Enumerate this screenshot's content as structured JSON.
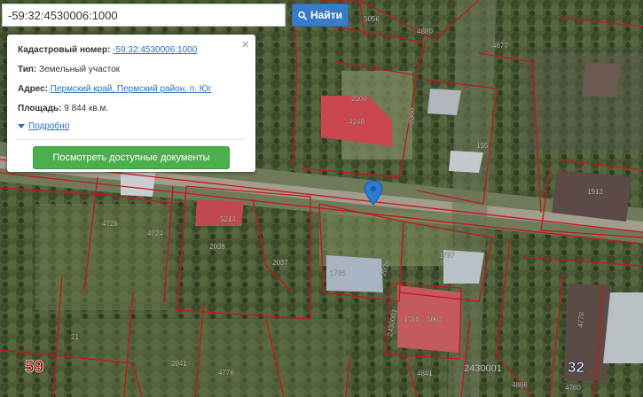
{
  "search": {
    "value": "-59:32:4530006:1000",
    "button_label": "Найти"
  },
  "popup": {
    "cadastral_label": "Кадастровый номер:",
    "cadastral_value": "-59:32:4530006:1000",
    "type_label": "Тип:",
    "type_value": "Земельный участок",
    "address_label": "Адрес:",
    "address_value": "Пермский край, Пермский район, п. Юг",
    "area_label": "Площадь:",
    "area_value": "9 844 кв.м.",
    "details_label": "Подробно",
    "docs_button_label": "Посмотреть доступные документы",
    "close_symbol": "×"
  },
  "map": {
    "parcel_labels": [
      "5056",
      "4880",
      "4877",
      "2300",
      "4240",
      "2300",
      "155",
      "1913",
      "5214",
      "4726",
      "4724",
      "2038",
      "2037",
      "1786",
      "2039",
      "1787",
      "1788",
      "5063",
      "4778",
      "21",
      "2041",
      "4776",
      "4841",
      "4886",
      "4780",
      "2430001"
    ],
    "district_labels": [
      "59",
      "32"
    ]
  },
  "colors": {
    "accent": "#3a7bc8",
    "docs_button": "#4cae4c",
    "parcel_border": "#c8151c",
    "marker": "#2e7ad1"
  }
}
